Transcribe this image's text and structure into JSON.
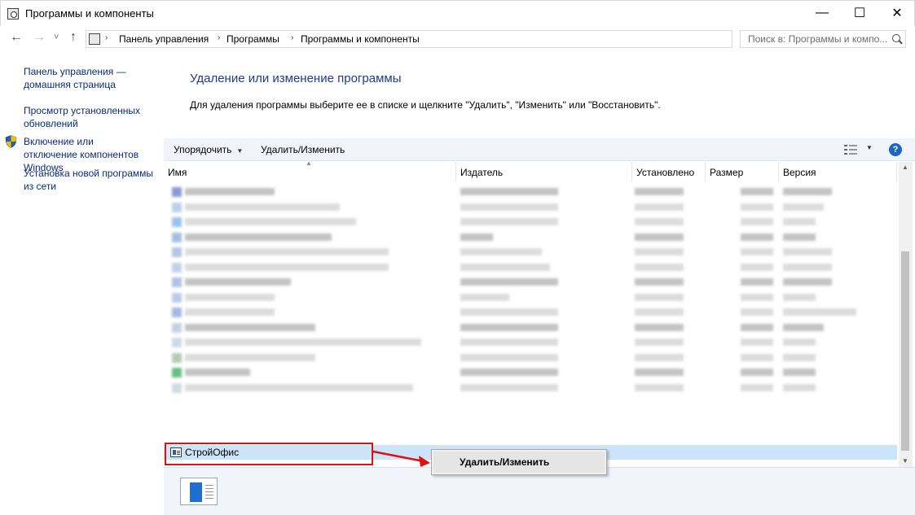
{
  "window": {
    "title": "Программы и компоненты",
    "controls": {
      "minimize": "—",
      "maximize": "☐",
      "close": "✕"
    }
  },
  "address": {
    "back": "←",
    "forward": "→",
    "history": "˅",
    "up": "↑",
    "crumbs": [
      "Панель управления",
      "Программы",
      "Программы и компоненты"
    ],
    "separator": "›",
    "dropdown": "˅",
    "refresh": "↻"
  },
  "search": {
    "placeholder": "Поиск в: Программы и компо..."
  },
  "leftnav": {
    "home": "Панель управления — домашняя страница",
    "updates": "Просмотр установленных обновлений",
    "features": "Включение или отключение компонентов Windows",
    "network_install": "Установка новой программы из сети"
  },
  "main": {
    "title": "Удаление или изменение программы",
    "description": "Для удаления программы выберите ее в списке и щелкните \"Удалить\", \"Изменить\" или \"Восстановить\"."
  },
  "toolbar": {
    "organize": "Упорядочить",
    "organize_arrow": "▼",
    "uninstall_change": "Удалить/Изменить",
    "view_arrow": "▼",
    "help": "?"
  },
  "columns": {
    "name": "Имя",
    "publisher": "Издатель",
    "installed": "Установлено",
    "size": "Размер",
    "version": "Версия",
    "sort_caret": "▲"
  },
  "selected_program": {
    "name": "СтройОфис"
  },
  "scrollbar": {
    "up": "▲",
    "down": "▼"
  },
  "context_menu": {
    "item": "Удалить/Изменить"
  },
  "colors": {
    "accent_title": "#1e3b8c",
    "link": "#0a2a7a",
    "selection": "#cce4f7",
    "annotation": "#e01010"
  }
}
